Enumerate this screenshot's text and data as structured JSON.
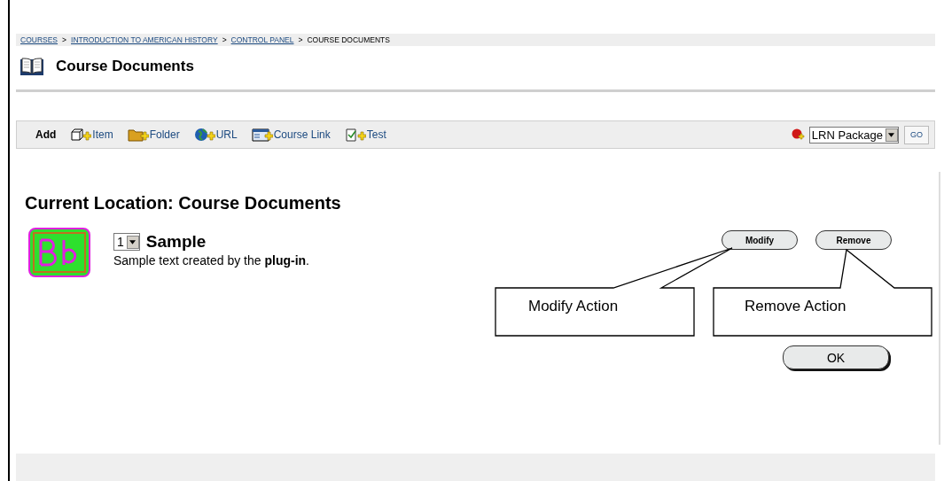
{
  "breadcrumbs": [
    {
      "label": "COURSES",
      "link": true
    },
    {
      "separator": ">",
      "label": "INTRODUCTION TO AMERICAN HISTORY",
      "link": true
    },
    {
      "separator": ">",
      "label": "CONTROL PANEL",
      "link": true
    },
    {
      "separator": ">",
      "label": "COURSE DOCUMENTS",
      "link": false
    }
  ],
  "page_title": "Course Documents",
  "toolbar": {
    "add_label": "Add",
    "items": [
      {
        "kind": "item",
        "label": "Item"
      },
      {
        "kind": "folder",
        "label": "Folder"
      },
      {
        "kind": "url",
        "label": "URL"
      },
      {
        "kind": "course_link",
        "label": "Course Link"
      },
      {
        "kind": "test",
        "label": "Test"
      }
    ],
    "package_select": "LRN Package",
    "go_button": "GO"
  },
  "location_heading": "Current Location: Course Documents",
  "content_item": {
    "order": "1",
    "title": "Sample",
    "description": "Sample text created by the **plug-in**.",
    "actions": [
      "Modify",
      "Remove"
    ]
  },
  "callouts": [
    {
      "label": "Modify Action"
    },
    {
      "label": "Remove Action"
    }
  ],
  "ok_button": "OK"
}
